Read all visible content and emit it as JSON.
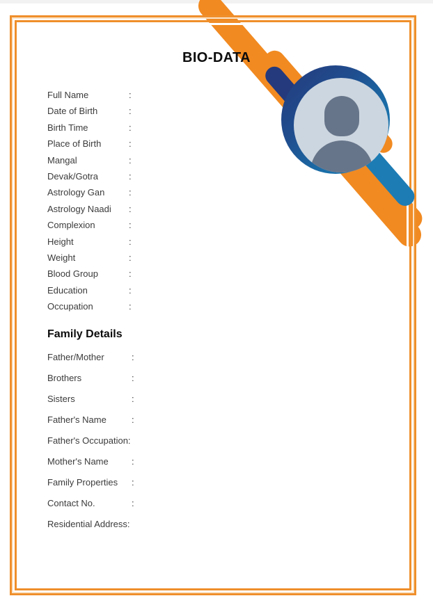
{
  "document": {
    "title": "BIO-DATA",
    "colon": ":",
    "section_family_title": "Family Details"
  },
  "theme": {
    "border_orange": "#ef8f2b",
    "border_pale": "#fbe3c6",
    "ribbon_orange": "#f18a21",
    "magnifier_dark_blue": "#253a7c",
    "magnifier_blue": "#1d7cb4",
    "lens_fill": "#ccd6e0",
    "avatar_gray": "#67758a",
    "text_gray": "#3b3b3b",
    "heading_black": "#0d0d0d"
  },
  "primary_fields": [
    {
      "label": "Full Name",
      "value": ""
    },
    {
      "label": "Date of Birth",
      "value": ""
    },
    {
      "label": "Birth Time",
      "value": ""
    },
    {
      "label": "Place of Birth",
      "value": ""
    },
    {
      "label": "Mangal",
      "value": ""
    },
    {
      "label": "Devak/Gotra",
      "value": ""
    },
    {
      "label": "Astrology Gan",
      "value": ""
    },
    {
      "label": "Astrology Naadi",
      "value": ""
    },
    {
      "label": "Complexion",
      "value": ""
    },
    {
      "label": "Height",
      "value": ""
    },
    {
      "label": "Weight",
      "value": ""
    },
    {
      "label": "Blood Group",
      "value": ""
    },
    {
      "label": "Education",
      "value": ""
    },
    {
      "label": "Occupation",
      "value": ""
    }
  ],
  "family_fields": [
    {
      "label": "Father/Mother",
      "value": "",
      "inline_colon": false
    },
    {
      "label": "Brothers",
      "value": "",
      "inline_colon": false
    },
    {
      "label": "Sisters",
      "value": "",
      "inline_colon": false
    },
    {
      "label": "Father's Name",
      "value": "",
      "inline_colon": false
    },
    {
      "label": "Father's Occupation:",
      "value": "",
      "inline_colon": true
    },
    {
      "label": "Mother's Name",
      "value": "",
      "inline_colon": false
    },
    {
      "label": "Family Properties",
      "value": "",
      "inline_colon": false
    },
    {
      "label": "Contact No.",
      "value": "",
      "inline_colon": false
    },
    {
      "label": "Residential Address:",
      "value": "",
      "inline_colon": true
    }
  ],
  "graphic": {
    "avatar_icon": "person-avatar-icon",
    "magnifier_icon": "magnifying-glass-icon",
    "ribbon_icon": "diagonal-ribbon-decoration"
  }
}
